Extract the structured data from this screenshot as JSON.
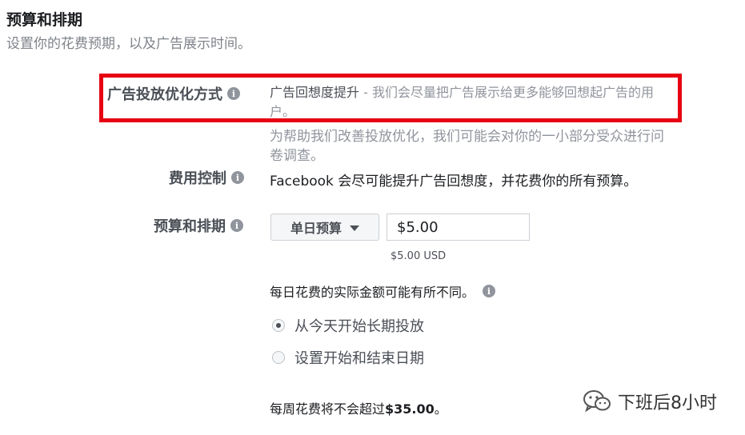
{
  "section": {
    "title": "预算和排期",
    "subtitle": "设置你的花费预期，以及广告展示时间。"
  },
  "optimization": {
    "label": "广告投放优化方式",
    "value": "广告回想度提升",
    "separator": " - ",
    "description": "我们会尽量把广告展示给更多能够回想起广告的用户。",
    "survey_note": "为帮助我们改善投放优化，我们可能会对你的一小部分受众进行问卷调查。"
  },
  "cost_control": {
    "label": "费用控制",
    "value": "Facebook 会尽可能提升广告回想度，并花费你的所有预算。"
  },
  "budget": {
    "label": "预算和排期",
    "type_selected": "单日预算",
    "amount": "$5.00",
    "amount_usd": "$5.00 USD",
    "daily_note": "每日花费的实际金额可能有所不同。"
  },
  "schedule": {
    "options": [
      {
        "label": "从今天开始长期投放",
        "selected": true
      },
      {
        "label": "设置开始和结束日期",
        "selected": false
      }
    ]
  },
  "weekly": {
    "prefix": "每周花费将不会超过",
    "amount": "$35.00",
    "suffix": "。"
  },
  "watermark": {
    "text": "下班后8小时",
    "icon": "wechat-icon"
  },
  "colors": {
    "highlight": "#e60012",
    "info_icon": "#90949c"
  }
}
